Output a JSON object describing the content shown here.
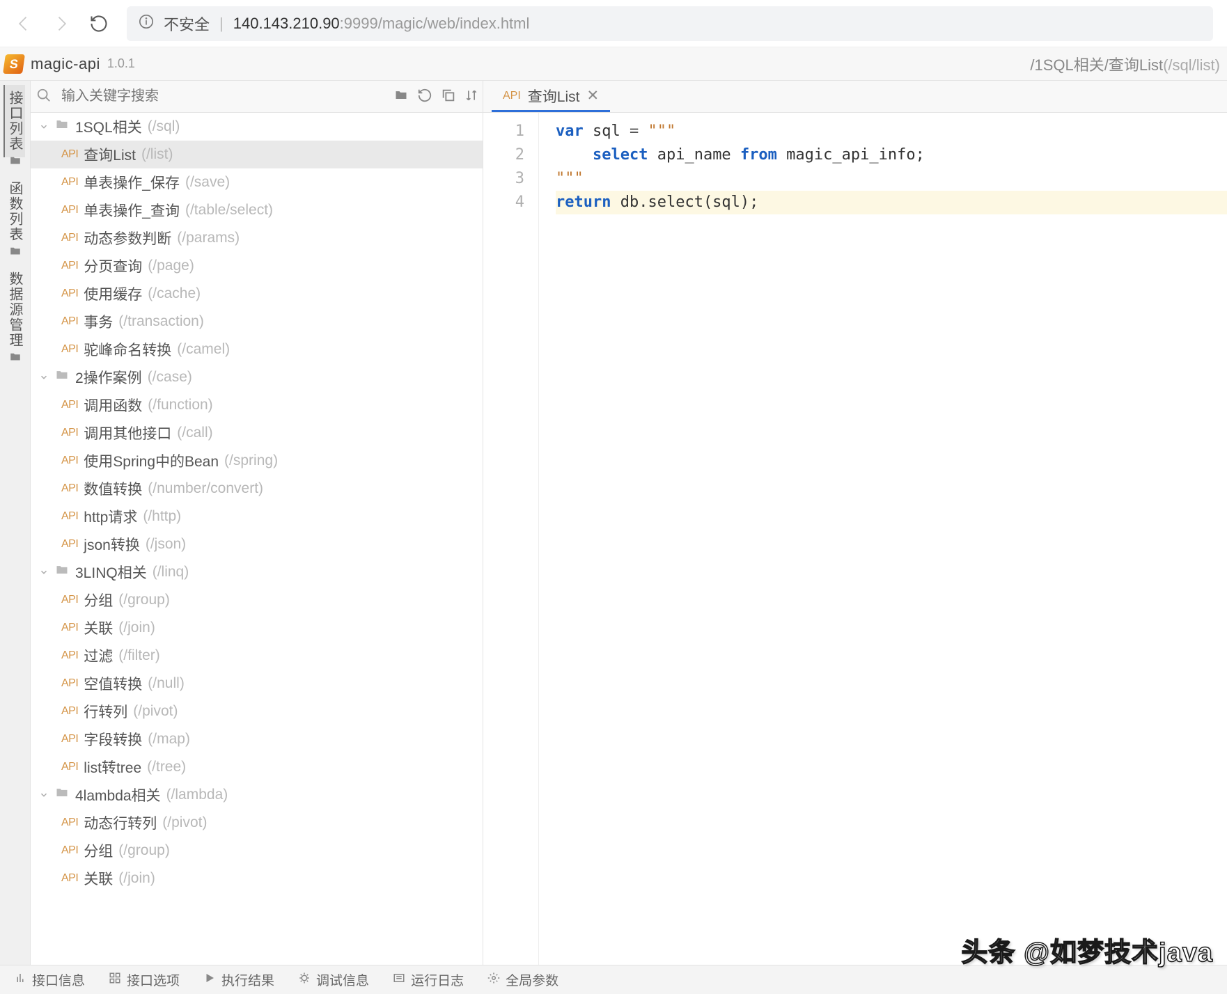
{
  "browser": {
    "not_secure_label": "不安全",
    "url_host": "140.143.210.90",
    "url_port": ":9999",
    "url_path": "/magic/web/index.html"
  },
  "app": {
    "title": "magic-api",
    "version": "1.0.1"
  },
  "breadcrumb": {
    "text": "/1SQL相关/查询List",
    "path": "(/sql/list)"
  },
  "left_rail": [
    {
      "label": "接口列表",
      "active": true
    },
    {
      "label": "函数列表",
      "active": false
    },
    {
      "label": "数据源管理",
      "active": false
    }
  ],
  "search": {
    "placeholder": "输入关键字搜索"
  },
  "tree": [
    {
      "type": "group",
      "open": true,
      "name": "1SQL相关",
      "path": "(/sql)",
      "children": [
        {
          "name": "查询List",
          "path": "(/list)",
          "selected": true
        },
        {
          "name": "单表操作_保存",
          "path": "(/save)"
        },
        {
          "name": "单表操作_查询",
          "path": "(/table/select)"
        },
        {
          "name": "动态参数判断",
          "path": "(/params)"
        },
        {
          "name": "分页查询",
          "path": "(/page)"
        },
        {
          "name": "使用缓存",
          "path": "(/cache)"
        },
        {
          "name": "事务",
          "path": "(/transaction)"
        },
        {
          "name": "驼峰命名转换",
          "path": "(/camel)"
        }
      ]
    },
    {
      "type": "group",
      "open": true,
      "name": "2操作案例",
      "path": "(/case)",
      "children": [
        {
          "name": "调用函数",
          "path": "(/function)"
        },
        {
          "name": "调用其他接口",
          "path": "(/call)"
        },
        {
          "name": "使用Spring中的Bean",
          "path": "(/spring)"
        },
        {
          "name": "数值转换",
          "path": "(/number/convert)"
        },
        {
          "name": "http请求",
          "path": "(/http)"
        },
        {
          "name": "json转换",
          "path": "(/json)"
        }
      ]
    },
    {
      "type": "group",
      "open": true,
      "name": "3LINQ相关",
      "path": "(/linq)",
      "children": [
        {
          "name": "分组",
          "path": "(/group)"
        },
        {
          "name": "关联",
          "path": "(/join)"
        },
        {
          "name": "过滤",
          "path": "(/filter)"
        },
        {
          "name": "空值转换",
          "path": "(/null)"
        },
        {
          "name": "行转列",
          "path": "(/pivot)"
        },
        {
          "name": "字段转换",
          "path": "(/map)"
        },
        {
          "name": "list转tree",
          "path": "(/tree)"
        }
      ]
    },
    {
      "type": "group",
      "open": true,
      "name": "4lambda相关",
      "path": "(/lambda)",
      "children": [
        {
          "name": "动态行转列",
          "path": "(/pivot)"
        },
        {
          "name": "分组",
          "path": "(/group)"
        },
        {
          "name": "关联",
          "path": "(/join)"
        }
      ]
    }
  ],
  "tabs": [
    {
      "label": "查询List",
      "active": true
    }
  ],
  "code": {
    "lines": [
      {
        "n": 1,
        "html": "<span class='kw'>var</span> <span class='ident'>sql</span> <span class='punct'>=</span> <span class='str'>\"\"\"</span>"
      },
      {
        "n": 2,
        "html": "    <span class='kw'>select</span> <span class='ident'>api_name</span> <span class='kw'>from</span> <span class='ident'>magic_api_info;</span>"
      },
      {
        "n": 3,
        "html": "<span class='str'>\"\"\"</span>"
      },
      {
        "n": 4,
        "html": "<span class='kw'>return</span> <span class='ident'>db.select(sql);</span>",
        "current": true
      }
    ]
  },
  "bottom_bar": [
    {
      "icon": "iface",
      "label": "接口信息"
    },
    {
      "icon": "grid",
      "label": "接口选项"
    },
    {
      "icon": "play",
      "label": "执行结果"
    },
    {
      "icon": "bug",
      "label": "调试信息"
    },
    {
      "icon": "log",
      "label": "运行日志"
    },
    {
      "icon": "gear",
      "label": "全局参数"
    }
  ],
  "watermark": "头条 @如梦技术java"
}
